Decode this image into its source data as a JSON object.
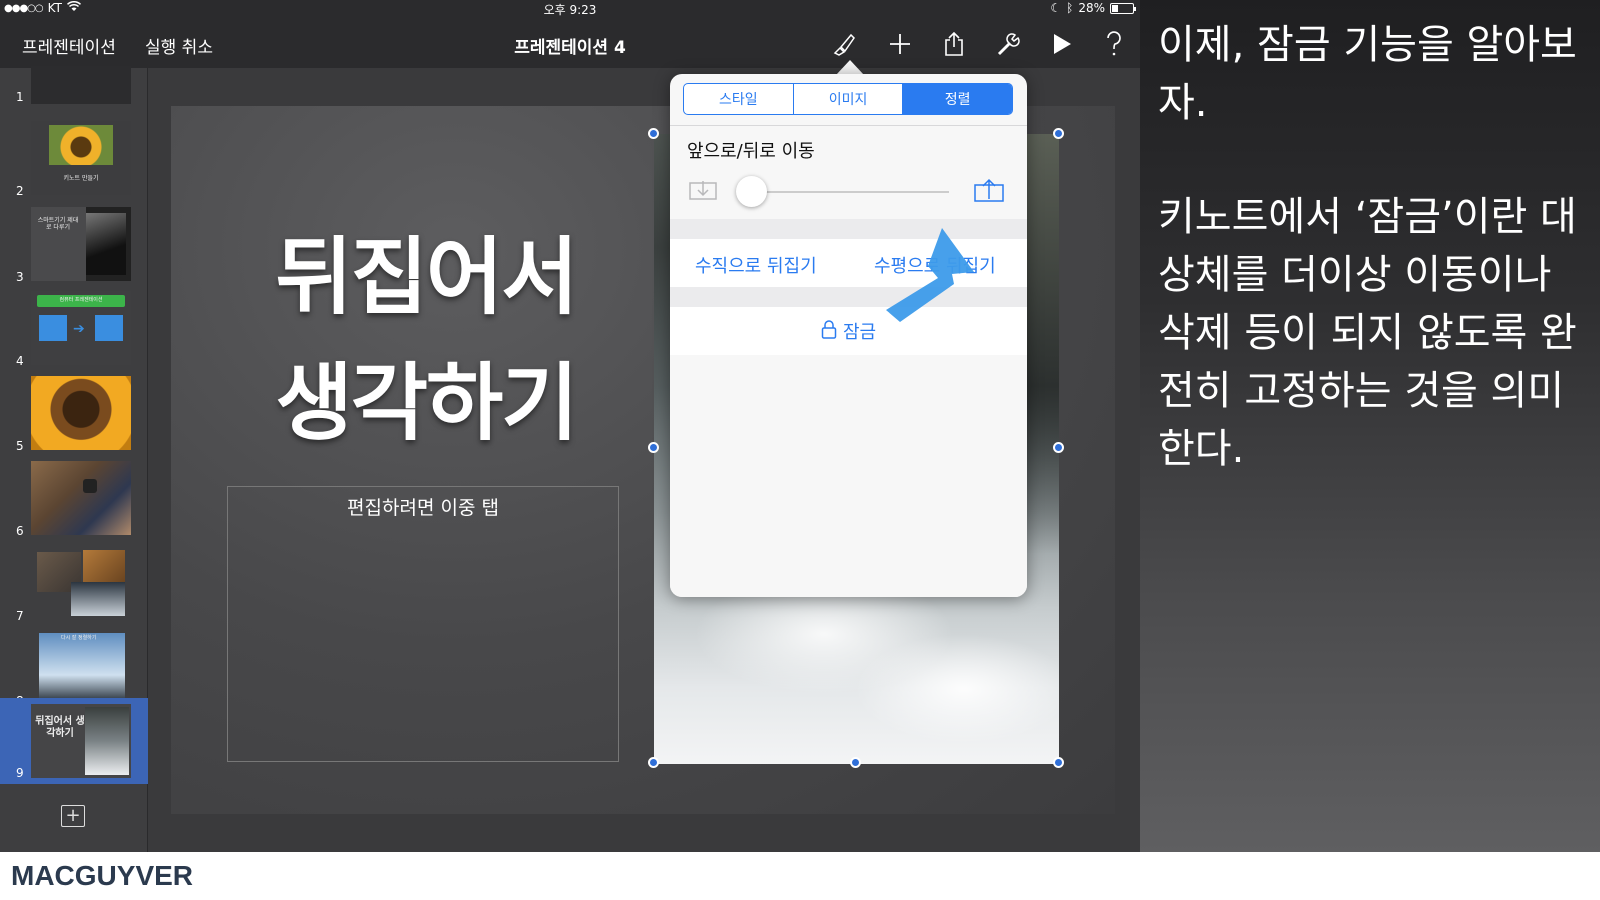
{
  "status_bar": {
    "carrier": "KT",
    "time": "오후 9:23",
    "battery": "28%"
  },
  "nav": {
    "presentations": "프레젠테이션",
    "undo": "실행 취소",
    "title": "프레젠테이션 4",
    "toolbar_icons": [
      "paintbrush-icon",
      "plus-icon",
      "share-icon",
      "wrench-icon",
      "play-icon",
      "help-icon"
    ]
  },
  "sidebar": {
    "slides": [
      {
        "num": "1",
        "label": ""
      },
      {
        "num": "2",
        "label": "키노트 만들기"
      },
      {
        "num": "3",
        "label": "스마트기기 제대로 다루기"
      },
      {
        "num": "4",
        "label": "컴퓨터 프레젠테이션"
      },
      {
        "num": "5",
        "label": ""
      },
      {
        "num": "6",
        "label": ""
      },
      {
        "num": "7",
        "label": ""
      },
      {
        "num": "8",
        "label": "다시 잘 정렬하기"
      },
      {
        "num": "9",
        "label": "뒤집어서 생각하기"
      }
    ],
    "selected": 9
  },
  "slide": {
    "title_line1": "뒤집어서",
    "title_line2": "생각하기",
    "placeholder": "편집하려면 이중 탭"
  },
  "popover": {
    "tabs": [
      {
        "label": "스타일",
        "active": false
      },
      {
        "label": "이미지",
        "active": false
      },
      {
        "label": "정렬",
        "active": true
      }
    ],
    "section_title": "앞으로/뒤로 이동",
    "slider_value": 0,
    "flip_vertical": "수직으로 뒤집기",
    "flip_horizontal": "수평으로 뒤집기",
    "lock": "잠금"
  },
  "right_panel": {
    "line1": "이제, 잠금 기능을 알아보자.",
    "line2": "키노트에서 ‘잠금’이란 대상체를 더이상 이동이나 삭제 등이 되지 않도록 완전히 고정하는 것을 의미한다."
  },
  "footer": {
    "brand": "MACGUYVER"
  },
  "colors": {
    "accent": "#2a7bf0",
    "selection": "#3c65b6",
    "handle": "#2f6fd8",
    "arrow": "#3d9bea"
  }
}
